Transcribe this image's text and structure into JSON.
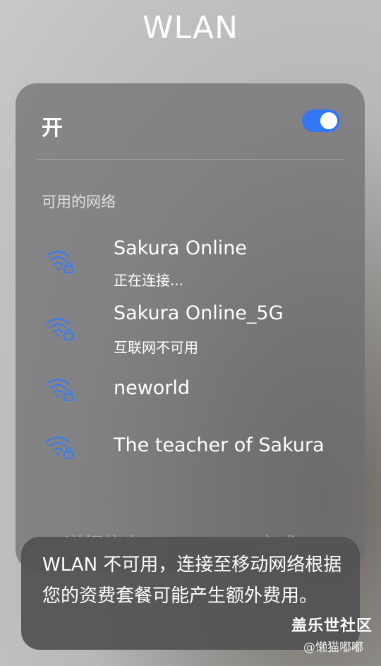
{
  "header": {
    "title": "WLAN"
  },
  "wlan": {
    "label": "开",
    "toggle_on": true,
    "accent_color": "#3477f6"
  },
  "networks_section": {
    "label": "可用的网络"
  },
  "networks": [
    {
      "name": "Sakura Online",
      "status": "正在连接...",
      "icon": "wifi-lock-icon"
    },
    {
      "name": "Sakura Online_5G",
      "status": "互联网不可用",
      "icon": "wifi-lock-icon"
    },
    {
      "name": "neworld",
      "status": "",
      "icon": "wifi-lock-icon"
    },
    {
      "name": "The teacher of Sakura",
      "status": "",
      "icon": "wifi-lock-icon"
    }
  ],
  "footer": {
    "details_label": "详细信息",
    "done_label": "完成"
  },
  "toast": {
    "message": "WLAN 不可用，连接至移动网络根据您的资费套餐可能产生额外费用。"
  },
  "watermark": {
    "site": "盖乐世社区",
    "user": "@懒猫嘟嘟"
  }
}
